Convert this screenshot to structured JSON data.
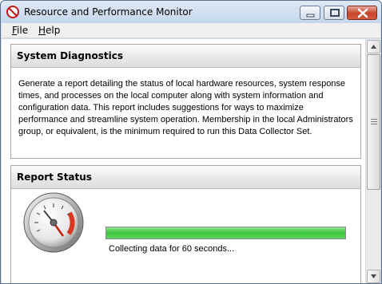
{
  "window": {
    "title": "Resource and Performance Monitor",
    "app_icon": "no-entry-icon",
    "title_buttons": [
      "minimize-icon",
      "maximize-icon",
      "close-icon"
    ]
  },
  "menu": {
    "items": [
      {
        "label": "File",
        "accel": "F"
      },
      {
        "label": "Help",
        "accel": "H"
      }
    ]
  },
  "sections": [
    {
      "title": "System Diagnostics",
      "body": "Generate a report detailing the status of local hardware resources, system response times, and processes on the local computer along with system information and configuration data. This report includes suggestions for ways to maximize performance and streamline system operation. Membership in the local Administrators group, or equivalent, is the minimum required to run this Data Collector Set."
    },
    {
      "title": "Report Status",
      "progress_fraction": 1.0,
      "status": "Collecting data for 60 seconds...",
      "icon": "gauge-icon"
    }
  ],
  "colors": {
    "title_bar": "#cfdcec",
    "progress_green": "#3cc63c",
    "close_button": "#c8452a",
    "gauge_red_zone": "#d9381e"
  }
}
